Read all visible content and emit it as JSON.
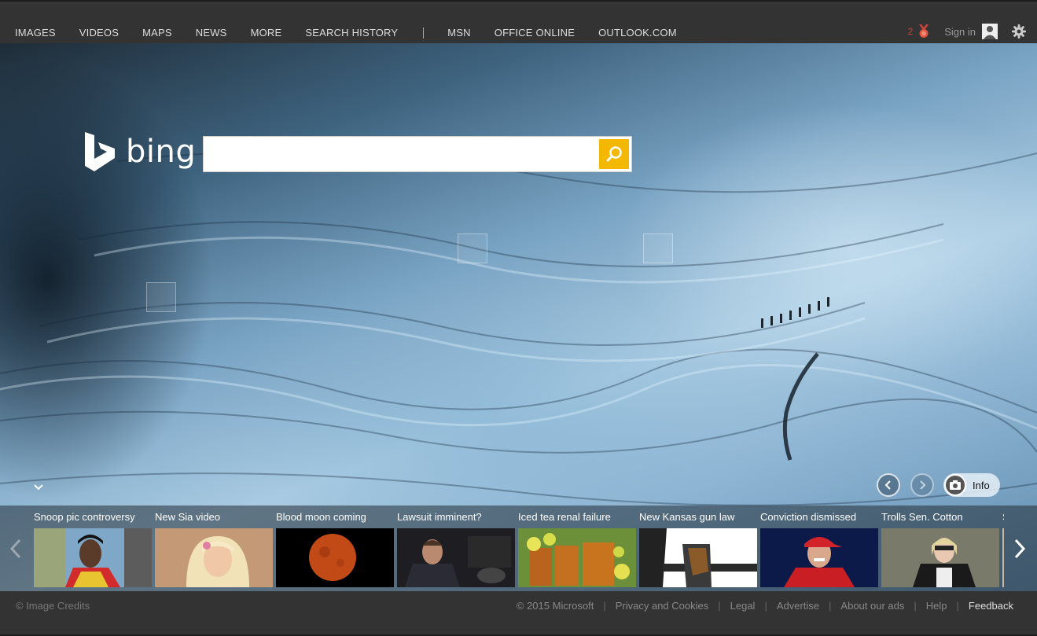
{
  "nav": {
    "items": [
      "IMAGES",
      "VIDEOS",
      "MAPS",
      "NEWS",
      "MORE",
      "SEARCH HISTORY"
    ],
    "msn_items": [
      "MSN",
      "OFFICE ONLINE",
      "OUTLOOK.COM"
    ],
    "reward_count": "2",
    "signin_label": "Sign in"
  },
  "logo": {
    "text": "bing"
  },
  "search": {
    "value": "",
    "placeholder": ""
  },
  "hero": {
    "info_label": "Info"
  },
  "news": {
    "tiles": [
      {
        "title": "Snoop pic controversy",
        "image": "snoop-photo"
      },
      {
        "title": "New Sia video",
        "image": "sia-photo"
      },
      {
        "title": "Blood moon coming",
        "image": "moon-photo"
      },
      {
        "title": "Lawsuit imminent?",
        "image": "lawsuit-photo"
      },
      {
        "title": "Iced tea renal failure",
        "image": "iced-tea-photo"
      },
      {
        "title": "New Kansas gun law",
        "image": "holster-photo"
      },
      {
        "title": "Conviction dismissed",
        "image": "vanilla-ice-photo"
      },
      {
        "title": "Trolls Sen. Cotton",
        "image": "cotton-photo"
      },
      {
        "title": "S",
        "image": "partial-photo"
      }
    ]
  },
  "footer": {
    "credits": "© Image Credits",
    "copyright": "© 2015 Microsoft",
    "links": [
      "Privacy and Cookies",
      "Legal",
      "Advertise",
      "About our ads",
      "Help",
      "Feedback"
    ]
  },
  "colors": {
    "search_button": "#f5b800",
    "top_bar": "#333333",
    "reward": "#c8443a"
  }
}
